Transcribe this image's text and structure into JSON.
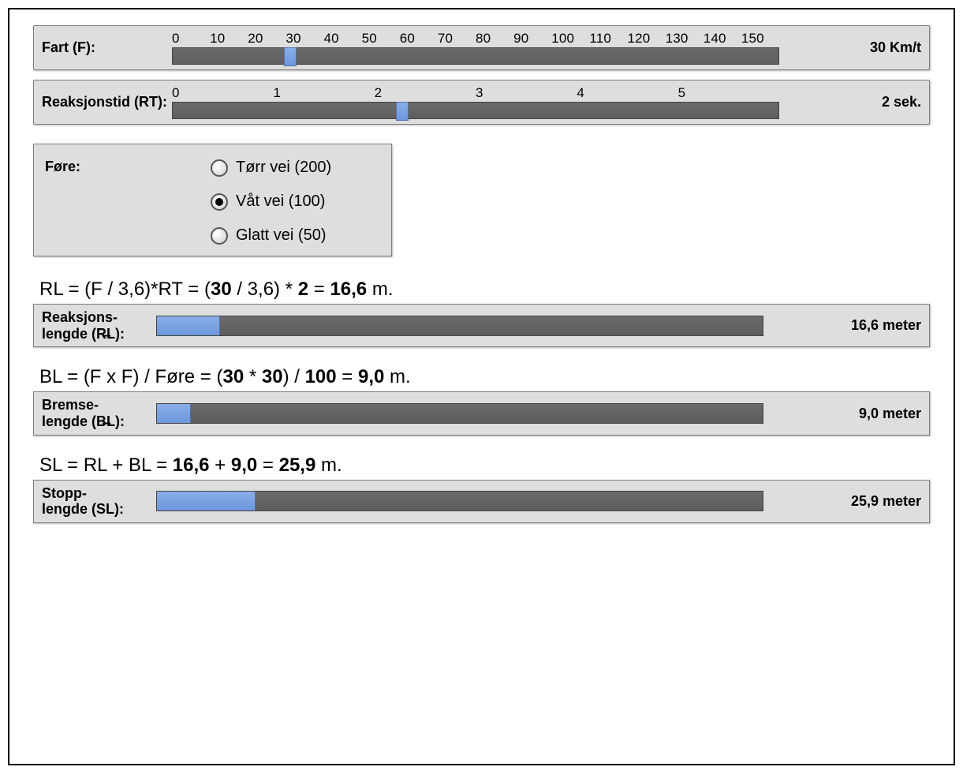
{
  "fart": {
    "label": "Fart (F):",
    "ticks": [
      "0",
      "10",
      "20",
      "30",
      "40",
      "50",
      "60",
      "70",
      "80",
      "90",
      "100",
      "110",
      "120",
      "130",
      "140",
      "150"
    ],
    "value": 30,
    "max": 155,
    "display": "30 Km/t"
  },
  "reaksjonstid": {
    "label": "Reaksjonstid (RT):",
    "ticks": [
      "0",
      "1",
      "2",
      "3",
      "4",
      "5"
    ],
    "value": 2,
    "max": 5.3,
    "display": "2 sek."
  },
  "fore": {
    "label": "Føre:",
    "options": [
      {
        "label": "Tørr vei (200)",
        "value": 200,
        "checked": false
      },
      {
        "label": "Våt vei (100)",
        "value": 100,
        "checked": true
      },
      {
        "label": "Glatt vei (50)",
        "value": 50,
        "checked": false
      }
    ]
  },
  "rl": {
    "formula_prefix": "RL = (F / 3,6)*RT = (",
    "F": "30",
    "mid1": " / 3,6) * ",
    "RT": "2",
    "mid2": " = ",
    "result": "16,6",
    "suffix": " m.",
    "panel_label": "Reaksjons-\nlengde (R̶L):",
    "value_display": "16,6 meter",
    "value_num": 16.6
  },
  "bl": {
    "formula_prefix": "BL = (F x F) / Føre = (",
    "F1": "30",
    "mid1": " * ",
    "F2": "30",
    "mid2": ") / ",
    "fore": "100",
    "mid3": " = ",
    "result": "9,0",
    "suffix": " m.",
    "panel_label": "Bremse-\nlengde (B̶L):",
    "value_display": "9,0 meter",
    "value_num": 9.0
  },
  "sl": {
    "formula_prefix": "SL = RL + BL = ",
    "RL": "16,6",
    "mid1": " + ",
    "BL": "9,0",
    "mid2": " = ",
    "result": "25,9",
    "suffix": " m.",
    "panel_label": "Stopp-\nlengde (SL):",
    "value_display": "25,9 meter",
    "value_num": 25.9
  },
  "bar_scale_max": 160
}
